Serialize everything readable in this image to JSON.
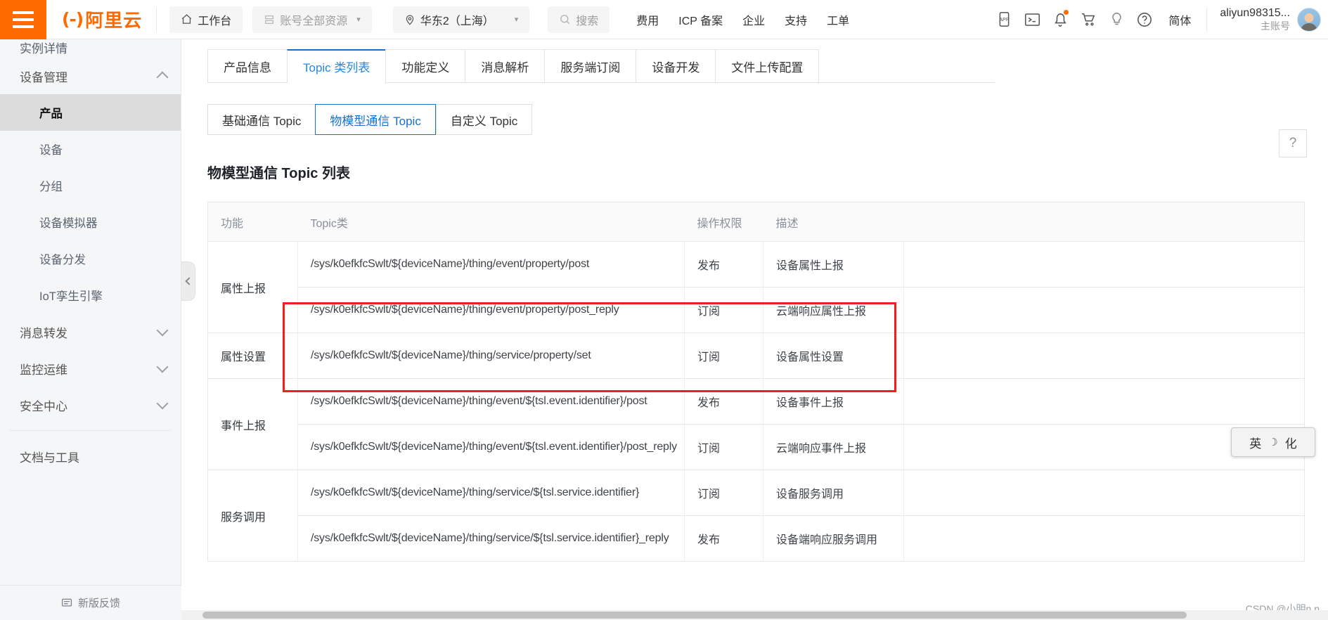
{
  "header": {
    "menu_icon": "hamburger-icon",
    "logo_text": "阿里云",
    "logo_mark": "(-)",
    "workbench": "工作台",
    "resources": "账号全部资源",
    "region": "华东2（上海）",
    "search_placeholder": "搜索",
    "links": [
      "费用",
      "ICP 备案",
      "企业",
      "支持",
      "工单"
    ],
    "language": "简体",
    "user_name": "aliyun98315...",
    "user_role": "主账号"
  },
  "sidebar": {
    "items": [
      {
        "label": "实例详情",
        "type": "cut"
      },
      {
        "label": "设备管理",
        "type": "group",
        "expanded": true
      },
      {
        "label": "产品",
        "type": "sub",
        "active": true
      },
      {
        "label": "设备",
        "type": "sub"
      },
      {
        "label": "分组",
        "type": "sub"
      },
      {
        "label": "设备模拟器",
        "type": "sub"
      },
      {
        "label": "设备分发",
        "type": "sub"
      },
      {
        "label": "IoT孪生引擎",
        "type": "sub"
      },
      {
        "label": "消息转发",
        "type": "group"
      },
      {
        "label": "监控运维",
        "type": "group"
      },
      {
        "label": "安全中心",
        "type": "group"
      }
    ],
    "docs_item": "文档与工具",
    "feedback": "新版反馈"
  },
  "tabs": [
    {
      "label": "产品信息",
      "active": false
    },
    {
      "label": "Topic 类列表",
      "active": true
    },
    {
      "label": "功能定义",
      "active": false
    },
    {
      "label": "消息解析",
      "active": false
    },
    {
      "label": "服务端订阅",
      "active": false
    },
    {
      "label": "设备开发",
      "active": false
    },
    {
      "label": "文件上传配置",
      "active": false
    }
  ],
  "subtabs": [
    {
      "label": "基础通信 Topic",
      "active": false
    },
    {
      "label": "物模型通信 Topic",
      "active": true
    },
    {
      "label": "自定义 Topic",
      "active": false
    }
  ],
  "panel": {
    "title": "物模型通信 Topic 列表",
    "help_icon": "question-mark-icon"
  },
  "table": {
    "columns": [
      "功能",
      "Topic类",
      "操作权限",
      "描述"
    ],
    "rows": [
      {
        "function": "属性上报",
        "rowspan": 2,
        "entries": [
          {
            "topic": "/sys/k0efkfcSwlt/${deviceName}/thing/event/property/post",
            "permission": "发布",
            "description": "设备属性上报"
          },
          {
            "topic": "/sys/k0efkfcSwlt/${deviceName}/thing/event/property/post_reply",
            "permission": "订阅",
            "description": "云端响应属性上报"
          }
        ]
      },
      {
        "function": "属性设置",
        "rowspan": 1,
        "entries": [
          {
            "topic": "/sys/k0efkfcSwlt/${deviceName}/thing/service/property/set",
            "permission": "订阅",
            "description": "设备属性设置"
          }
        ]
      },
      {
        "function": "事件上报",
        "rowspan": 2,
        "entries": [
          {
            "topic": "/sys/k0efkfcSwlt/${deviceName}/thing/event/${tsl.event.identifier}/post",
            "permission": "发布",
            "description": "设备事件上报"
          },
          {
            "topic": "/sys/k0efkfcSwlt/${deviceName}/thing/event/${tsl.event.identifier}/post_reply",
            "permission": "订阅",
            "description": "云端响应事件上报"
          }
        ]
      },
      {
        "function": "服务调用",
        "rowspan": 2,
        "entries": [
          {
            "topic": "/sys/k0efkfcSwlt/${deviceName}/thing/service/${tsl.service.identifier}",
            "permission": "订阅",
            "description": "设备服务调用"
          },
          {
            "topic": "/sys/k0efkfcSwlt/${deviceName}/thing/service/${tsl.service.identifier}_reply",
            "permission": "发布",
            "description": "设备端响应服务调用"
          }
        ]
      }
    ]
  },
  "annotation": {
    "highlight_color": "#ee1f1f"
  },
  "ime": {
    "lang": "英",
    "moon": "☽",
    "punct": "化"
  },
  "watermark": "CSDN @小明n.n"
}
